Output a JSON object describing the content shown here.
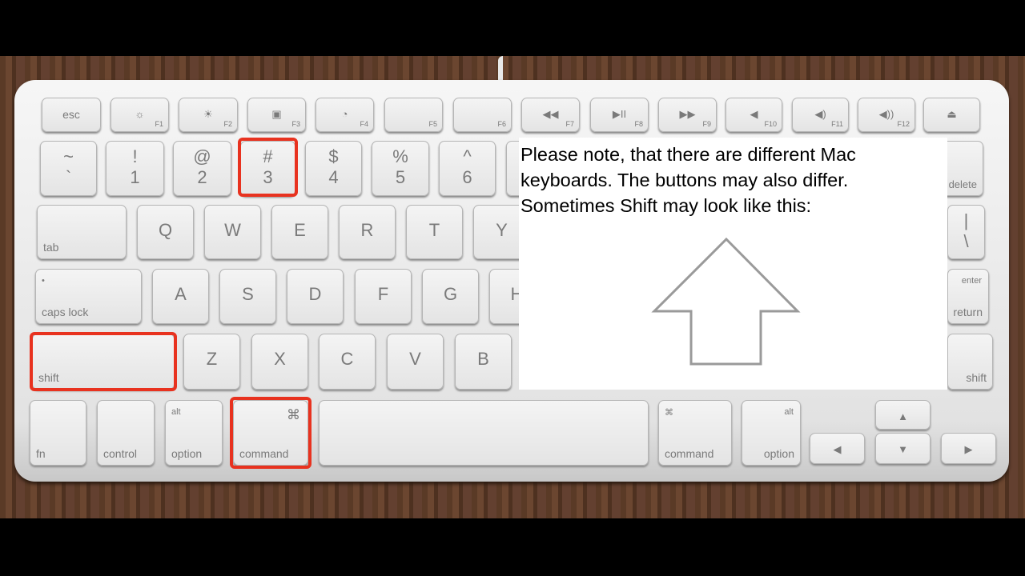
{
  "keys": [
    {
      "id": "esc",
      "mid": "esc"
    },
    {
      "id": "f1",
      "icon": "☼",
      "fn": "F1"
    },
    {
      "id": "f2",
      "icon": "☀",
      "fn": "F2"
    },
    {
      "id": "f3",
      "icon": "▣",
      "fn": "F3"
    },
    {
      "id": "f4",
      "icon": "◔",
      "fn": "F4"
    },
    {
      "id": "f5",
      "fn": "F5"
    },
    {
      "id": "f6",
      "fn": "F6"
    },
    {
      "id": "f7",
      "icon": "◀◀",
      "fn": "F7"
    },
    {
      "id": "f8",
      "icon": "▶II",
      "fn": "F8"
    },
    {
      "id": "f9",
      "icon": "▶▶",
      "fn": "F9"
    },
    {
      "id": "f10",
      "icon": "◀",
      "fn": "F10"
    },
    {
      "id": "f11",
      "icon": "◀)",
      "fn": "F11"
    },
    {
      "id": "f12",
      "icon": "◀))",
      "fn": "F12"
    },
    {
      "id": "eject",
      "icon": "⏏"
    },
    {
      "id": "tilde",
      "top": "~",
      "bot": "`"
    },
    {
      "id": "1",
      "top": "!",
      "bot": "1"
    },
    {
      "id": "2",
      "top": "@",
      "bot": "2"
    },
    {
      "id": "3",
      "top": "#",
      "bot": "3"
    },
    {
      "id": "4",
      "top": "$",
      "bot": "4"
    },
    {
      "id": "5",
      "top": "%",
      "bot": "5"
    },
    {
      "id": "6",
      "top": "^",
      "bot": "6"
    },
    {
      "id": "7"
    },
    {
      "id": "delete",
      "br": "delete"
    },
    {
      "id": "tab",
      "bl": "tab"
    },
    {
      "id": "q",
      "mid": "Q"
    },
    {
      "id": "w",
      "mid": "W"
    },
    {
      "id": "e",
      "mid": "E"
    },
    {
      "id": "r",
      "mid": "R"
    },
    {
      "id": "t",
      "mid": "T"
    },
    {
      "id": "y",
      "mid": "Y"
    },
    {
      "id": "backslash",
      "top": "|",
      "bot": "\\"
    },
    {
      "id": "caps-lock",
      "tl": "•",
      "bl": "caps lock"
    },
    {
      "id": "a",
      "mid": "A"
    },
    {
      "id": "s",
      "mid": "S"
    },
    {
      "id": "d",
      "mid": "D"
    },
    {
      "id": "f",
      "mid": "F"
    },
    {
      "id": "g",
      "mid": "G"
    },
    {
      "id": "h",
      "mid": "H"
    },
    {
      "id": "return",
      "tr2": "enter",
      "br": "return"
    },
    {
      "id": "shift-left",
      "bl": "shift"
    },
    {
      "id": "z",
      "mid": "Z"
    },
    {
      "id": "x",
      "mid": "X"
    },
    {
      "id": "c",
      "mid": "C"
    },
    {
      "id": "v",
      "mid": "V"
    },
    {
      "id": "b",
      "mid": "B"
    },
    {
      "id": "shift-right",
      "br": "shift"
    },
    {
      "id": "fn",
      "bl": "fn"
    },
    {
      "id": "control",
      "bl": "control"
    },
    {
      "id": "option-left",
      "tl": "alt",
      "bl": "option"
    },
    {
      "id": "command-left",
      "tr": "⌘",
      "bl": "command"
    },
    {
      "id": "space"
    },
    {
      "id": "command-right",
      "tl": "⌘",
      "bl": "command"
    },
    {
      "id": "option-right",
      "tr2": "alt",
      "br": "option"
    },
    {
      "id": "arrow-left",
      "icon": "◀"
    },
    {
      "id": "arrow-up",
      "icon": "▲"
    },
    {
      "id": "arrow-down",
      "icon": "▼"
    },
    {
      "id": "arrow-right",
      "icon": "▶"
    }
  ],
  "highlighted_keys": [
    "3",
    "shift-left",
    "command-left"
  ],
  "highlight_color": "#e8321f",
  "note": {
    "lines": [
      "Please note, that there are different Mac",
      "keyboards. The buttons may also differ.",
      "Sometimes Shift may look like this:"
    ],
    "icon": "shift-arrow-icon"
  }
}
